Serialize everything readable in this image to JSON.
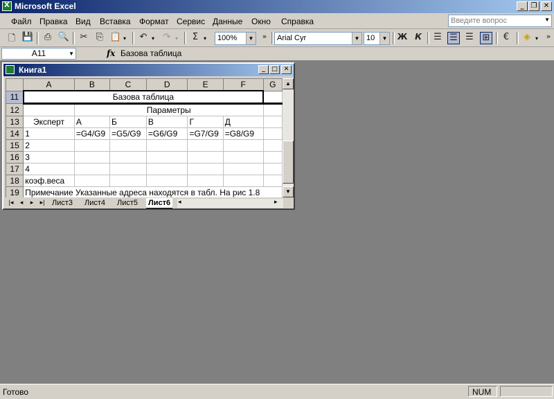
{
  "app": {
    "title": "Microsoft Excel"
  },
  "menu": {
    "items": [
      "Файл",
      "Правка",
      "Вид",
      "Вставка",
      "Формат",
      "Сервис",
      "Данные",
      "Окно",
      "Справка"
    ],
    "help_placeholder": "Введите вопрос"
  },
  "toolbar": {
    "zoom": "100%",
    "font_name": "Arial Cyr",
    "font_size": "10",
    "bold": "Ж",
    "italic": "К",
    "sum": "Σ",
    "more": "»"
  },
  "formula_bar": {
    "name_box": "A11",
    "fx": "fx",
    "formula": "Базова таблица"
  },
  "workbook": {
    "title": "Книга1",
    "columns": [
      "A",
      "B",
      "C",
      "D",
      "E",
      "F",
      "G"
    ],
    "rows": [
      {
        "num": "11",
        "cells": [
          "Базова таблица"
        ]
      },
      {
        "num": "12",
        "cells": [
          "",
          "Параметры"
        ]
      },
      {
        "num": "13",
        "cells": [
          "Эксперт",
          "А",
          "Б",
          "В",
          "Г",
          "Д"
        ]
      },
      {
        "num": "14",
        "cells": [
          "1",
          "=G4/G9",
          "=G5/G9",
          "=G6/G9",
          "=G7/G9",
          "=G8/G9"
        ]
      },
      {
        "num": "15",
        "cells": [
          "2"
        ]
      },
      {
        "num": "16",
        "cells": [
          "3"
        ]
      },
      {
        "num": "17",
        "cells": [
          "4"
        ]
      },
      {
        "num": "18",
        "cells": [
          "коэф.веса"
        ]
      },
      {
        "num": "19",
        "cells": [
          "Примечание Указанные адреса находятся в табл. На рис 1.8"
        ]
      }
    ],
    "tabs": [
      "Лист3",
      "Лист4",
      "Лист5",
      "Лист6"
    ],
    "active_tab": "Лист6"
  },
  "status": {
    "ready": "Готово",
    "num": "NUM"
  },
  "colors": {
    "title_start": "#0a246a",
    "title_end": "#a6caf0",
    "chrome": "#d4d0c8",
    "workspace": "#808080"
  }
}
